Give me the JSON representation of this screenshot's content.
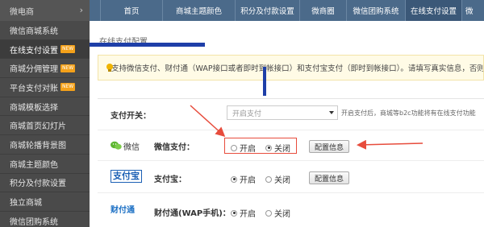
{
  "sidebar": {
    "header": "微电商",
    "items": [
      {
        "label": "微信商城系统",
        "badge": ""
      },
      {
        "label": "在线支付设置",
        "badge": "NEW"
      },
      {
        "label": "商城分佣管理",
        "badge": "NEW"
      },
      {
        "label": "平台支付对账",
        "badge": "NEW"
      },
      {
        "label": "商城模板选择",
        "badge": ""
      },
      {
        "label": "商城首页幻灯片",
        "badge": ""
      },
      {
        "label": "商城轮播背景图",
        "badge": ""
      },
      {
        "label": "商城主题颜色",
        "badge": ""
      },
      {
        "label": "积分及付款设置",
        "badge": ""
      },
      {
        "label": "独立商城",
        "badge": ""
      },
      {
        "label": "微信团购系统",
        "badge": ""
      }
    ]
  },
  "topnav": {
    "tabs": [
      "首页",
      "商城主题颜色",
      "积分及付款设置",
      "微商圈",
      "微信团购系统",
      "在线支付设置",
      "微"
    ]
  },
  "main": {
    "section_title": "在线支付配置",
    "notice": "支持微信支付、财付通（WAP接口或者即时到帐接口）和支付宝支付（即时到帐接口）。请填写真实信息，否则支付",
    "switch": {
      "label": "支付开关：",
      "selected": "开启支付",
      "hint": "开启支付后，商城等b2c功能将有在线支付功能"
    },
    "payments": [
      {
        "logo_text": "微信",
        "label": "微信支付：",
        "on": "开启",
        "off": "关闭",
        "selected": "off",
        "button": "配置信息"
      },
      {
        "logo_text": "支付宝",
        "label": "支付宝：",
        "on": "开启",
        "off": "关闭",
        "selected": "on",
        "button": "配置信息"
      },
      {
        "logo_text": "财付通",
        "label": "财付通(WAP手机)：",
        "on": "开启",
        "off": "关闭",
        "selected": "on",
        "button": ""
      }
    ]
  },
  "colors": {
    "sidebar_bg": "#4a4a4a",
    "topnav_bg": "#4b6a8a",
    "badge": "#f4a11a",
    "annotation_blue": "#1e3fa8",
    "annotation_red": "#e74c3c"
  }
}
